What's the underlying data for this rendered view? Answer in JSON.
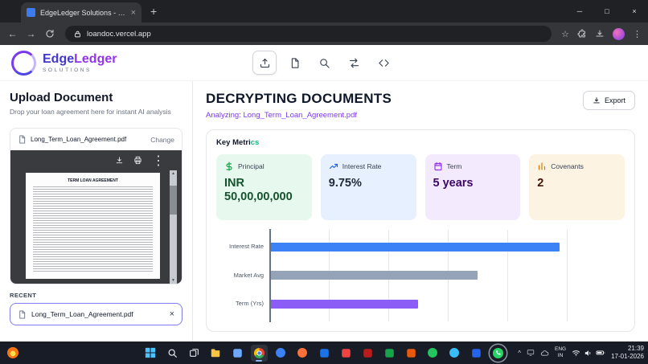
{
  "browser": {
    "tab_title": "EdgeLedger Solutions - Digital...",
    "url": "loandoc.vercel.app"
  },
  "app_header": {
    "brand_part1": "Edge",
    "brand_part2": "Ledger",
    "brand_sub": "SOLUTIONS",
    "active_tool": 0,
    "tools": [
      {
        "name": "upload",
        "icon": "upload"
      },
      {
        "name": "document",
        "icon": "document"
      },
      {
        "name": "search",
        "icon": "search"
      },
      {
        "name": "compare",
        "icon": "compare"
      },
      {
        "name": "code",
        "icon": "code"
      }
    ]
  },
  "left_panel": {
    "title": "Upload Document",
    "subtitle": "Drop your loan agreement here for instant AI analysis",
    "file_name": "Long_Term_Loan_Agreement.pdf",
    "change_label": "Change",
    "preview_title": "TERM LOAN AGREEMENT",
    "recent_label": "RECENT",
    "recent_file": "Long_Term_Loan_Agreement.pdf"
  },
  "main": {
    "title": "DECRYPTING DOCUMENTS",
    "subtitle": "Analyzing: Long_Term_Loan_Agreement.pdf",
    "export_label": "Export",
    "key_metrics_main": "Key Metri",
    "key_metrics_accent": "cs",
    "metrics": [
      {
        "id": "principal",
        "label": "Principal",
        "value": "INR 50,00,00,000",
        "icon": "dollar",
        "bg": "#e7f8ee",
        "accent": "#16a34a",
        "value_color": "#14532d"
      },
      {
        "id": "interest-rate",
        "label": "Interest Rate",
        "value": "9.75%",
        "icon": "trend",
        "bg": "#e7f0fe",
        "accent": "#2563eb",
        "value_color": "#1e293b"
      },
      {
        "id": "term",
        "label": "Term",
        "value": "5 years",
        "icon": "calendar",
        "bg": "#f4eafe",
        "accent": "#9333ea",
        "value_color": "#3b0764"
      },
      {
        "id": "covenants",
        "label": "Covenants",
        "value": "2",
        "icon": "bars",
        "bg": "#fdf3e3",
        "accent": "#d97706",
        "value_color": "#431407"
      }
    ]
  },
  "chart_data": {
    "type": "bar",
    "orientation": "horizontal",
    "title": "",
    "xlabel": "",
    "ylabel": "",
    "categories": [
      "Interest Rate",
      "Market Avg",
      "Term (Yrs)"
    ],
    "values": [
      9.75,
      7,
      5
    ],
    "colors": [
      "#3b82f6",
      "#94a3b8",
      "#8b5cf6"
    ],
    "xlim": [
      0,
      10
    ],
    "grid": true,
    "grid_step": 2,
    "legend": "none"
  },
  "taskbar": {
    "icons": [
      {
        "name": "start-icon",
        "type": "start",
        "color": "#4cc2ff"
      },
      {
        "name": "search-icon",
        "type": "magnifier",
        "color": "#e8eaed"
      },
      {
        "name": "task-view-icon",
        "type": "taskview",
        "color": "#e8eaed"
      },
      {
        "name": "file-explorer-icon",
        "type": "folder",
        "color": "#f6c344"
      },
      {
        "name": "photos-icon",
        "type": "square",
        "color": "#6ea8fe"
      },
      {
        "name": "chrome-icon",
        "type": "chrome",
        "color": "#4285f4",
        "active": true
      },
      {
        "name": "edge-icon",
        "type": "circle",
        "color": "#3b82f6"
      },
      {
        "name": "firefox-icon",
        "type": "circle",
        "color": "#ff7139"
      },
      {
        "name": "outlook-icon",
        "type": "square",
        "color": "#1a73e8"
      },
      {
        "name": "gmail-icon",
        "type": "square",
        "color": "#ef4444"
      },
      {
        "name": "store-icon",
        "type": "square",
        "color": "#b91c1c"
      },
      {
        "name": "excel-icon",
        "type": "square",
        "color": "#16a34a"
      },
      {
        "name": "powerpoint-icon",
        "type": "square",
        "color": "#ea580c"
      },
      {
        "name": "spotify-icon",
        "type": "circle",
        "color": "#22c55e"
      },
      {
        "name": "telegram-icon",
        "type": "circle",
        "color": "#38bdf8"
      },
      {
        "name": "paint-icon",
        "type": "square",
        "color": "#2563eb"
      },
      {
        "name": "whatsapp-icon",
        "type": "whatsapp",
        "color": "#25d366",
        "ring": true
      }
    ],
    "tray": {
      "lang1": "ENG",
      "lang2": "IN",
      "time": "21:39",
      "date": "17-01-2026"
    }
  }
}
